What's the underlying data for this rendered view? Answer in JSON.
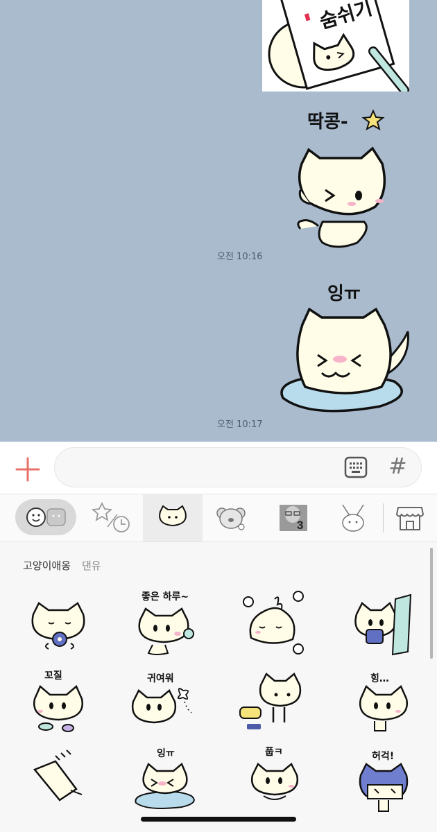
{
  "chat": {
    "messages": [
      {
        "sticker": "cat-holding-paper-sticker",
        "caption": "숨쉬기"
      },
      {
        "sticker": "cat-wink-star-sticker",
        "caption": "딱콩-",
        "time": "오전 10:16"
      },
      {
        "sticker": "cat-crying-puddle-sticker",
        "caption": "잉ㅠ",
        "time": "오전 10:17"
      }
    ]
  },
  "input": {
    "placeholder": "",
    "plus_icon": "plus-icon",
    "keyboard_icon": "keyboard-icon",
    "hash_label": "#"
  },
  "tabs": {
    "items": [
      {
        "name": "emoticon-tab",
        "icon": "emoji-face-icon"
      },
      {
        "name": "recent-tab",
        "icon": "star-clock-icon"
      },
      {
        "name": "cat-pack-tab",
        "icon": "cat-face-icon",
        "selected": true
      },
      {
        "name": "koala-pack-tab",
        "icon": "koala-icon"
      },
      {
        "name": "photo-pack-tab",
        "icon": "photo-thumbnail-icon",
        "badge": "3"
      },
      {
        "name": "bunny-pack-tab",
        "icon": "bunny-icon"
      },
      {
        "name": "store-tab",
        "icon": "store-icon"
      }
    ]
  },
  "pack": {
    "title": "고양이애옹",
    "author": "댄유"
  },
  "stickers": {
    "row1": [
      {
        "caption": "",
        "icon": "cat-eating-donut-sticker"
      },
      {
        "caption": "좋은 하루~",
        "icon": "cat-flower-sticker"
      },
      {
        "caption": "",
        "icon": "cat-melting-sticker"
      },
      {
        "caption": "",
        "icon": "cat-door-peek-sticker"
      }
    ],
    "row2": [
      {
        "caption": "꼬질",
        "icon": "cat-dirty-sticker"
      },
      {
        "caption": "귀여워",
        "icon": "cat-butterfly-sticker"
      },
      {
        "caption": "",
        "icon": "cat-speech-bubble-sticker"
      },
      {
        "caption": "힝…",
        "icon": "cat-sad-sticker"
      }
    ],
    "row3": [
      {
        "caption": "",
        "icon": "cat-fallen-sticker"
      },
      {
        "caption": "잉ㅠ",
        "icon": "cat-crying-sticker"
      },
      {
        "caption": "풉ㅋ",
        "icon": "cat-laughing-sticker"
      },
      {
        "caption": "허걱!",
        "icon": "cat-shocked-sticker"
      }
    ]
  },
  "colors": {
    "chat_background": "#a9bbcd",
    "accent_plus": "#e9706a",
    "cat_fill": "#fffde8",
    "blush": "#f6b3c9",
    "puddle": "#b9dcec"
  }
}
